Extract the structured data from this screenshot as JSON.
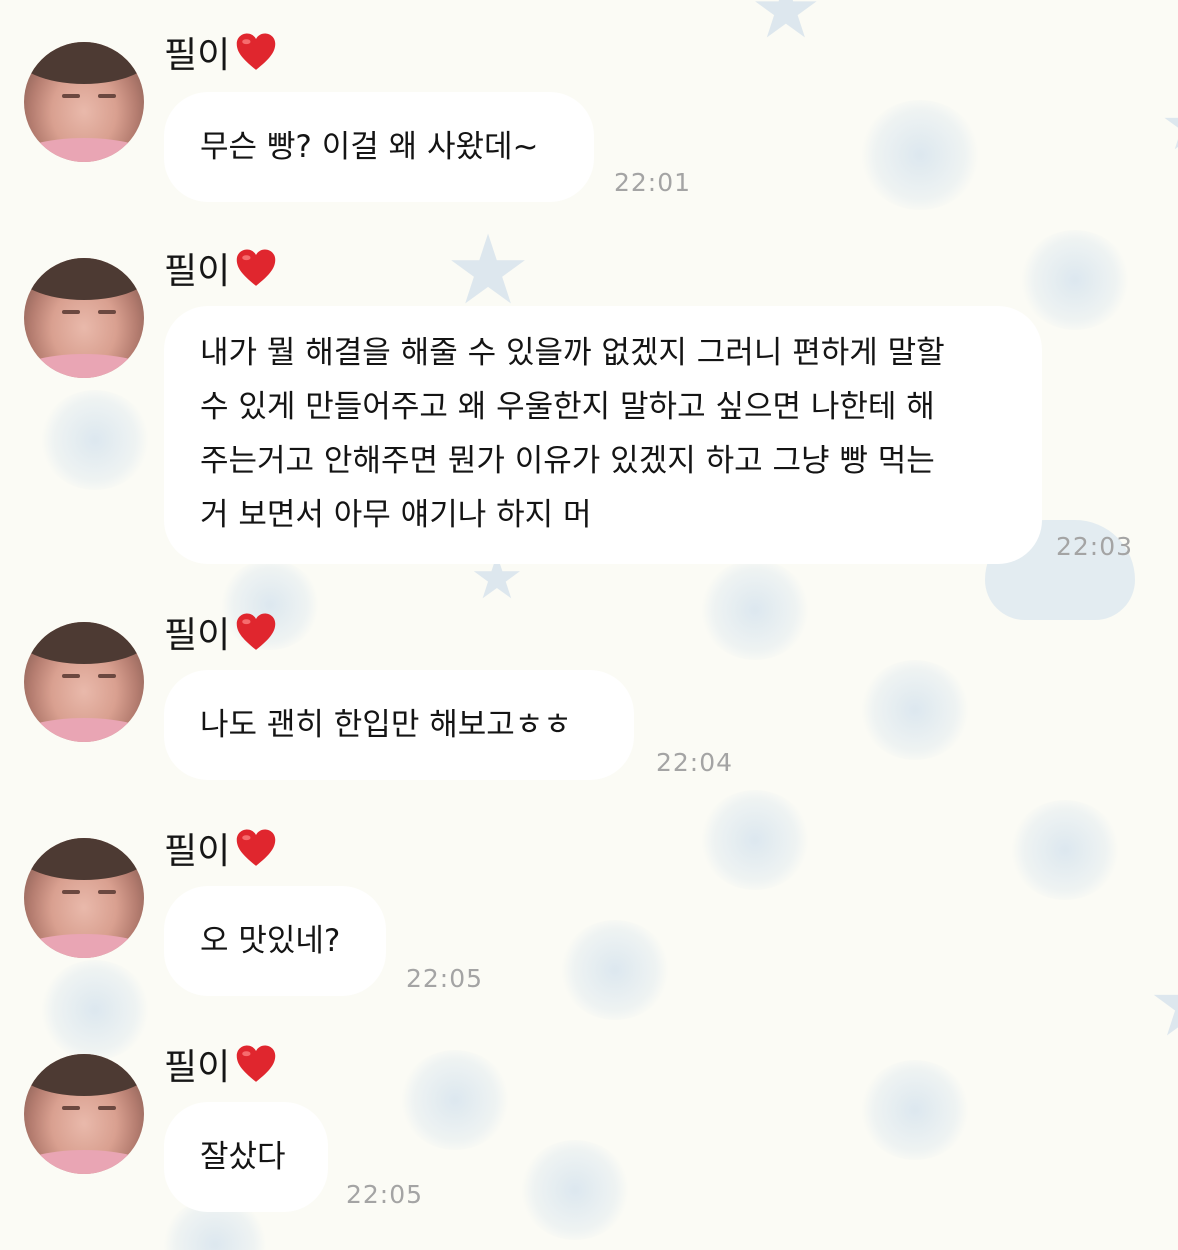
{
  "chat": {
    "messages": [
      {
        "sender": "필이",
        "lines": [
          "무슨 빵? 이걸 왜 사왔데~"
        ],
        "time": "22:01"
      },
      {
        "sender": "필이",
        "lines": [
          "내가 뭘 해결을 해줄 수 있을까 없겠지 그러니 편하게 말할",
          "수 있게 만들어주고 왜 우울한지 말하고 싶으면 나한테 해",
          "주는거고 안해주면 뭔가 이유가 있겠지 하고 그냥 빵 먹는",
          "거 보면서 아무 얘기나 하지 머"
        ],
        "time": "22:03"
      },
      {
        "sender": "필이",
        "lines": [
          "나도 괜히 한입만 해보고ㅎㅎ"
        ],
        "time": "22:04"
      },
      {
        "sender": "필이",
        "lines": [
          "오 맛있네?"
        ],
        "time": "22:05"
      },
      {
        "sender": "필이",
        "lines": [
          "잘샀다"
        ],
        "time": "22:05"
      }
    ],
    "icons": {
      "avatar": "profile-photo",
      "heart": "red-heart-icon"
    },
    "colors": {
      "background": "#fbfbf5",
      "bubble": "#ffffff",
      "time": "#a4a4a4",
      "heart": "#e0262e"
    }
  }
}
